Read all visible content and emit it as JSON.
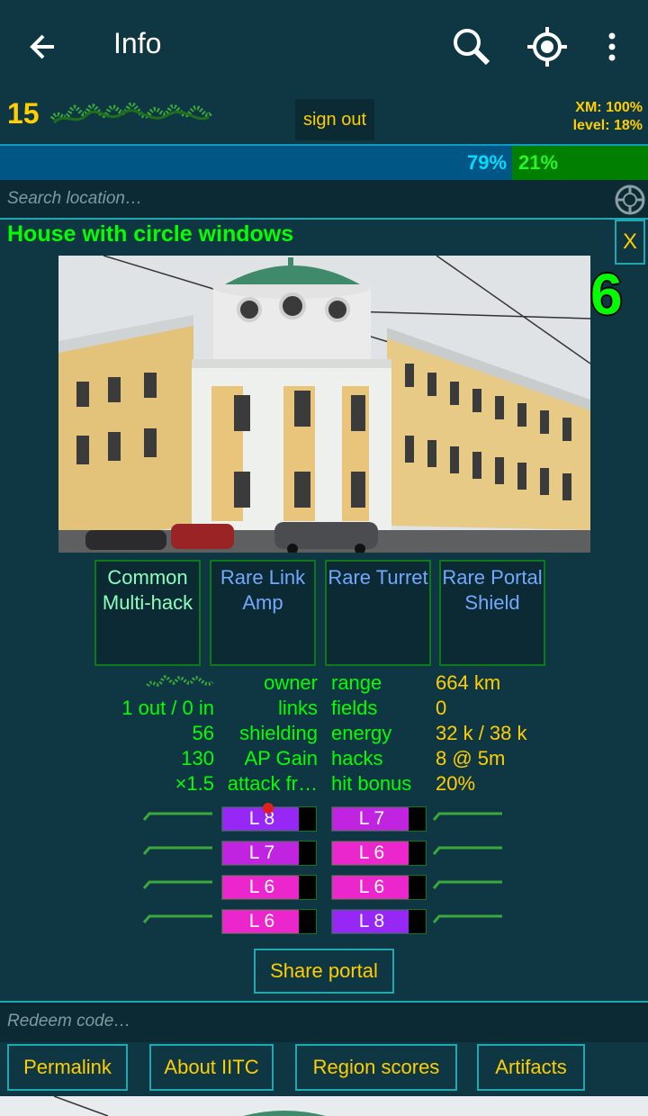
{
  "appbar": {
    "title": "Info"
  },
  "player": {
    "level": "15",
    "signout_label": "sign out",
    "xm_line": "XM: 100%",
    "level_line": "level: 18%"
  },
  "faction": {
    "res_pct": "79%",
    "enl_pct": "21%",
    "res_share": 0.79
  },
  "search": {
    "placeholder": "Search location…"
  },
  "portal": {
    "title": "House with circle windows",
    "close_label": "X",
    "level": "6",
    "mods": [
      {
        "label": "Common Multi-hack",
        "rarity": "common"
      },
      {
        "label": "Rare Link Amp",
        "rarity": "rare"
      },
      {
        "label": "Rare Turret",
        "rarity": "rare"
      },
      {
        "label": "Rare Portal Shield",
        "rarity": "rare"
      }
    ],
    "stats_left": [
      {
        "value": "",
        "label": "owner"
      },
      {
        "value": "1 out / 0 in",
        "label": "links"
      },
      {
        "value": "56",
        "label": "shielding"
      },
      {
        "value": "130",
        "label": "AP Gain"
      },
      {
        "value": "×1.5",
        "label": "attack fr…"
      }
    ],
    "stats_right": [
      {
        "label": "range",
        "value": "664 km"
      },
      {
        "label": "fields",
        "value": "0"
      },
      {
        "label": "energy",
        "value": "32 k / 38 k"
      },
      {
        "label": "hacks",
        "value": "8 @ 5m"
      },
      {
        "label": "hit bonus",
        "value": "20%"
      }
    ],
    "resonators_left": [
      {
        "label": "L  8",
        "level": 8,
        "color": "#9627f4",
        "fill": 0.82
      },
      {
        "label": "L  7",
        "level": 7,
        "color": "#c124e0",
        "fill": 0.82
      },
      {
        "label": "L  6",
        "level": 6,
        "color": "#eb26cd",
        "fill": 0.82
      },
      {
        "label": "L  6",
        "level": 6,
        "color": "#eb26cd",
        "fill": 0.82
      }
    ],
    "resonators_right": [
      {
        "label": "L  7",
        "level": 7,
        "color": "#c124e0",
        "fill": 0.82
      },
      {
        "label": "L  6",
        "level": 6,
        "color": "#eb26cd",
        "fill": 0.82
      },
      {
        "label": "L  6",
        "level": 6,
        "color": "#eb26cd",
        "fill": 0.82
      },
      {
        "label": "L  8",
        "level": 8,
        "color": "#9627f4",
        "fill": 0.82
      }
    ],
    "share_label": "Share portal"
  },
  "redeem": {
    "placeholder": "Redeem code…"
  },
  "toolbox": [
    {
      "label": "Permalink"
    },
    {
      "label": "About IITC"
    },
    {
      "label": "Region scores"
    },
    {
      "label": "Artifacts"
    }
  ],
  "colors": {
    "enlightened": "#03fe03",
    "resistance": "#03dcfe",
    "accent": "#ffce00",
    "border": "#20a8b1"
  }
}
